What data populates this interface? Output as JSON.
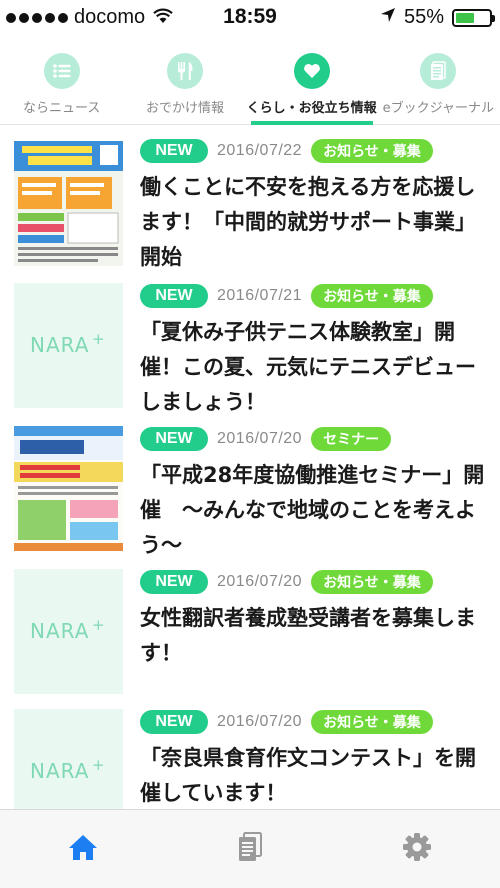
{
  "status_bar": {
    "carrier": "docomo",
    "time": "18:59",
    "battery_text": "55%",
    "battery_level": 0.55
  },
  "tabs": [
    {
      "label": "ならニュース",
      "icon": "list-icon",
      "active": false
    },
    {
      "label": "おでかけ情報",
      "icon": "fork-knife-icon",
      "active": false
    },
    {
      "label": "くらし・お役立ち情報",
      "icon": "heart-icon",
      "active": true
    },
    {
      "label": "eブックジャーナル",
      "icon": "document-icon",
      "active": false
    }
  ],
  "articles": [
    {
      "new_label": "NEW",
      "date": "2016/07/22",
      "category": "お知らせ・募集",
      "title": "働くことに不安を抱える方を応援します！「中間的就労サポート事業」開始",
      "thumbnail": "flyer-image"
    },
    {
      "new_label": "NEW",
      "date": "2016/07/21",
      "category": "お知らせ・募集",
      "title": "「夏休み子供テニス体験教室」開催！この夏、元気にテニスデビューしましょう！",
      "thumbnail": "placeholder-logo"
    },
    {
      "new_label": "NEW",
      "date": "2016/07/20",
      "category": "セミナー",
      "title": "「平成28年度協働推進セミナー」開催　～みんなで地域のことを考えよう～",
      "thumbnail": "seminar-flyer-image"
    },
    {
      "new_label": "NEW",
      "date": "2016/07/20",
      "category": "お知らせ・募集",
      "title": "女性翻訳者養成塾受講者を募集します！",
      "thumbnail": "placeholder-logo"
    },
    {
      "new_label": "NEW",
      "date": "2016/07/20",
      "category": "お知らせ・募集",
      "title": "「奈良県食育作文コンテスト」を開催しています！",
      "thumbnail": "placeholder-logo"
    }
  ],
  "logo_text": "NARA+",
  "bottom_bar": [
    {
      "icon": "home-icon",
      "active": true
    },
    {
      "icon": "document-icon",
      "active": false
    },
    {
      "icon": "gear-icon",
      "active": false
    }
  ],
  "colors": {
    "accent": "#22cc8a",
    "accent_light": "#b6ecd8",
    "category_badge": "#6fd93a",
    "home_active": "#1c7ef0",
    "inactive_icon": "#9a9a9a"
  }
}
